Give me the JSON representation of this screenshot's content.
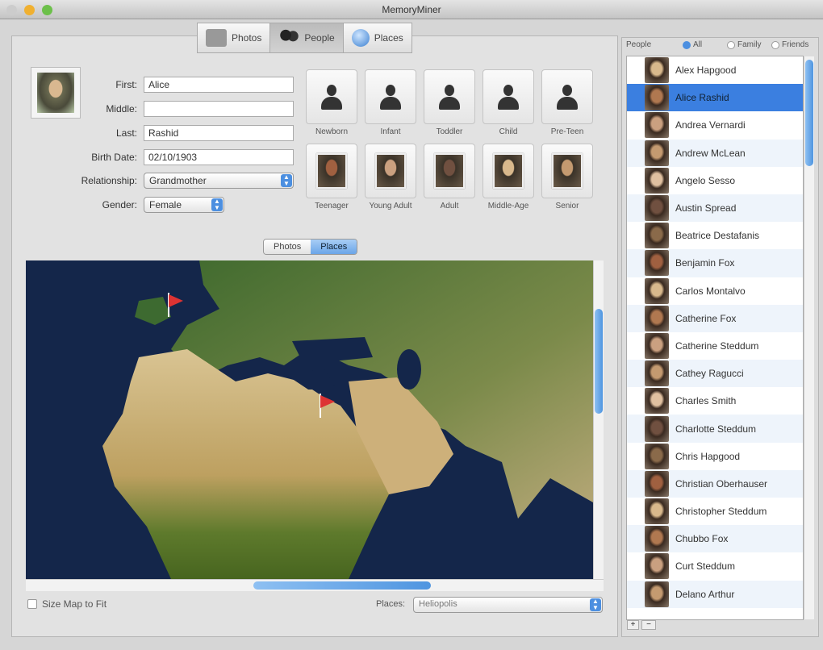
{
  "window": {
    "title": "MemoryMiner"
  },
  "toolbar": {
    "tabs": [
      {
        "label": "Photos"
      },
      {
        "label": "People"
      },
      {
        "label": "Places"
      }
    ],
    "selected": "People"
  },
  "person": {
    "fields": [
      {
        "label": "First:",
        "value": "Alice"
      },
      {
        "label": "Middle:",
        "value": ""
      },
      {
        "label": "Last:",
        "value": "Rashid"
      },
      {
        "label": "Birth Date:",
        "value": "02/10/1903"
      }
    ],
    "relationship": {
      "label": "Relationship:",
      "value": "Grandmother"
    },
    "gender": {
      "label": "Gender:",
      "value": "Female"
    }
  },
  "ages": [
    {
      "label": "Newborn",
      "has_photo": false
    },
    {
      "label": "Infant",
      "has_photo": false
    },
    {
      "label": "Toddler",
      "has_photo": false
    },
    {
      "label": "Child",
      "has_photo": false
    },
    {
      "label": "Pre-Teen",
      "has_photo": false
    },
    {
      "label": "Teenager",
      "has_photo": true
    },
    {
      "label": "Young Adult",
      "has_photo": true
    },
    {
      "label": "Adult",
      "has_photo": true
    },
    {
      "label": "Middle-Age",
      "has_photo": true
    },
    {
      "label": "Senior",
      "has_photo": true
    }
  ],
  "subview": {
    "tabs": [
      {
        "label": "Photos"
      },
      {
        "label": "Places"
      }
    ],
    "selected": "Places"
  },
  "map_bottom": {
    "size_to_fit_label": "Size Map to Fit",
    "size_to_fit_checked": false,
    "places_label": "Places:",
    "places_value": "Heliopolis"
  },
  "people_panel": {
    "title": "People",
    "filters": [
      {
        "label": "All",
        "checked": true
      },
      {
        "label": "Family",
        "checked": false
      },
      {
        "label": "Friends",
        "checked": false
      }
    ],
    "people": [
      "Alex Hapgood",
      "Alice Rashid",
      "Andrea Vernardi",
      "Andrew McLean",
      "Angelo Sesso",
      "Austin Spread",
      "Beatrice Destafanis",
      "Benjamin Fox",
      "Carlos Montalvo",
      "Catherine Fox",
      "Catherine Steddum",
      "Cathey Ragucci",
      "Charles Smith",
      "Charlotte Steddum",
      "Chris Hapgood",
      "Christian Oberhauser",
      "Christopher Steddum",
      "Chubbo Fox",
      "Curt Steddum",
      "Delano Arthur"
    ],
    "selected": "Alice Rashid",
    "add_label": "+",
    "remove_label": "−"
  }
}
